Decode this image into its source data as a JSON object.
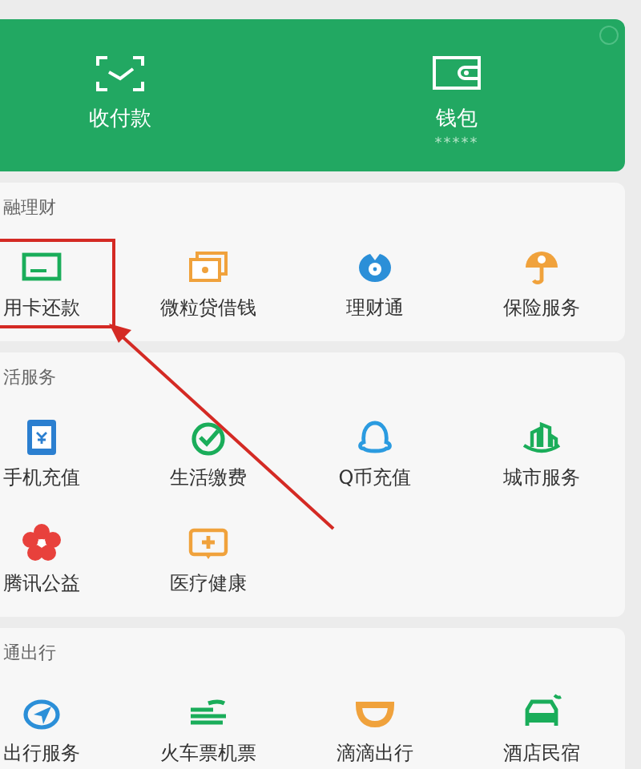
{
  "top_card": {
    "actions": [
      {
        "label": "收付款"
      },
      {
        "label": "钱包",
        "sub": "*****"
      }
    ]
  },
  "sections": [
    {
      "title": "融理财",
      "items": [
        {
          "label": "用卡还款",
          "highlighted": true
        },
        {
          "label": "微粒贷借钱",
          "highlighted": false
        },
        {
          "label": "理财通",
          "highlighted": false
        },
        {
          "label": "保险服务",
          "highlighted": false
        }
      ]
    },
    {
      "title": "活服务",
      "items": [
        {
          "label": "手机充值",
          "highlighted": false
        },
        {
          "label": "生活缴费",
          "highlighted": false
        },
        {
          "label": "Q币充值",
          "highlighted": false
        },
        {
          "label": "城市服务",
          "highlighted": false
        },
        {
          "label": "腾讯公益",
          "highlighted": false
        },
        {
          "label": "医疗健康",
          "highlighted": false
        }
      ]
    },
    {
      "title": "通出行",
      "items": [
        {
          "label": "出行服务",
          "highlighted": false
        },
        {
          "label": "火车票机票",
          "highlighted": false
        },
        {
          "label": "滴滴出行",
          "highlighted": false
        },
        {
          "label": "酒店民宿",
          "highlighted": false
        }
      ]
    }
  ]
}
